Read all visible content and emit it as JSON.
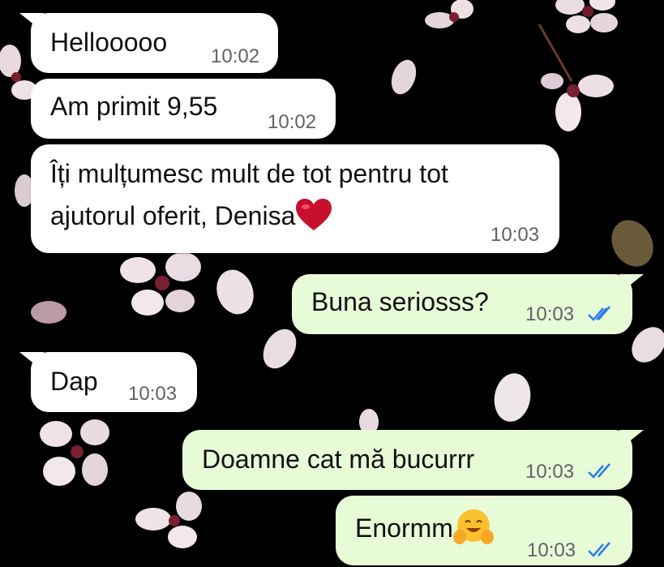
{
  "chat": {
    "messages": [
      {
        "dir": "in",
        "text": "Hellooooo",
        "time": "10:02"
      },
      {
        "dir": "in",
        "text": "Am primit 9,55",
        "time": "10:02"
      },
      {
        "dir": "in",
        "line1": "Îți mulțumesc mult de tot pentru tot",
        "line2": "ajutorul oferit, Denisa",
        "emoji": "red-heart-emoji",
        "time": "10:03"
      },
      {
        "dir": "out",
        "text": "Buna seriosss?",
        "time": "10:03",
        "status": "read-double-check"
      },
      {
        "dir": "in",
        "text": "Dap",
        "time": "10:03"
      },
      {
        "dir": "out",
        "text": "Doamne cat mă bucurrr",
        "time": "10:03",
        "status": "read-double-check"
      },
      {
        "dir": "out",
        "text": "Enormm",
        "emoji": "smiling-face-with-open-hands-emoji",
        "time": "10:03",
        "status": "read-double-check"
      }
    ]
  },
  "colors": {
    "wallpaper_bg": "#000000",
    "incoming_bubble": "#ffffff",
    "outgoing_bubble": "#e7fbd7",
    "read_ticks": "#2f80ed",
    "petal": "#f2e6ea",
    "petal_center": "#7a1f33"
  }
}
